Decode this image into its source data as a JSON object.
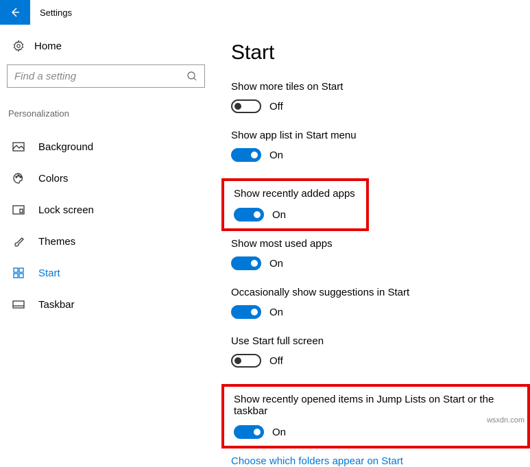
{
  "header": {
    "app_title": "Settings"
  },
  "sidebar": {
    "home_label": "Home",
    "search_placeholder": "Find a setting",
    "section_title": "Personalization",
    "items": [
      {
        "id": "background",
        "label": "Background"
      },
      {
        "id": "colors",
        "label": "Colors"
      },
      {
        "id": "lockscreen",
        "label": "Lock screen"
      },
      {
        "id": "themes",
        "label": "Themes"
      },
      {
        "id": "start",
        "label": "Start"
      },
      {
        "id": "taskbar",
        "label": "Taskbar"
      }
    ]
  },
  "main": {
    "title": "Start",
    "settings": [
      {
        "label": "Show more tiles on Start",
        "state": "Off",
        "on": false
      },
      {
        "label": "Show app list in Start menu",
        "state": "On",
        "on": true
      },
      {
        "label": "Show recently added apps",
        "state": "On",
        "on": true
      },
      {
        "label": "Show most used apps",
        "state": "On",
        "on": true
      },
      {
        "label": "Occasionally show suggestions in Start",
        "state": "On",
        "on": true
      },
      {
        "label": "Use Start full screen",
        "state": "Off",
        "on": false
      },
      {
        "label": "Show recently opened items in Jump Lists on Start or the taskbar",
        "state": "On",
        "on": true
      }
    ],
    "link": "Choose which folders appear on Start"
  },
  "watermark": "wsxdn.com"
}
